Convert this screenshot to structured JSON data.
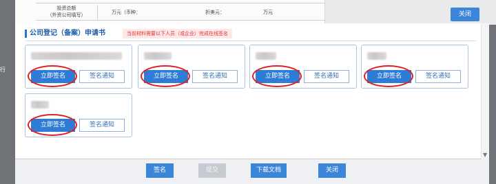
{
  "background_doc": {
    "label_line1": "投资总额",
    "label_line2": "（外资公司填写）",
    "amount_text": "万元（币种：",
    "usd_text": "折美元：",
    "unit_text": "万元"
  },
  "top_close_label": "关闭",
  "dialog": {
    "title": "公司登记（备案）申请书",
    "notice": "当前材料需要以下人员（或企业）完成在线签名"
  },
  "signers": [
    {
      "sign_label": "立即签名",
      "notify_label": "签名通知"
    },
    {
      "sign_label": "立即签名",
      "notify_label": "签名通知"
    },
    {
      "sign_label": "立即签名",
      "notify_label": "签名通知"
    },
    {
      "sign_label": "立即签名",
      "notify_label": "签名通知"
    },
    {
      "sign_label": "立即签名",
      "notify_label": "签名通知"
    }
  ],
  "footer": {
    "sign": "签名",
    "submit": "提交",
    "download": "下载文档",
    "close": "关闭"
  },
  "colors": {
    "accent": "#2e7cd6",
    "highlight_ring": "#e02020",
    "notice_text": "#e23434"
  },
  "icons": {
    "scroll_down": "chevron-down-icon"
  }
}
